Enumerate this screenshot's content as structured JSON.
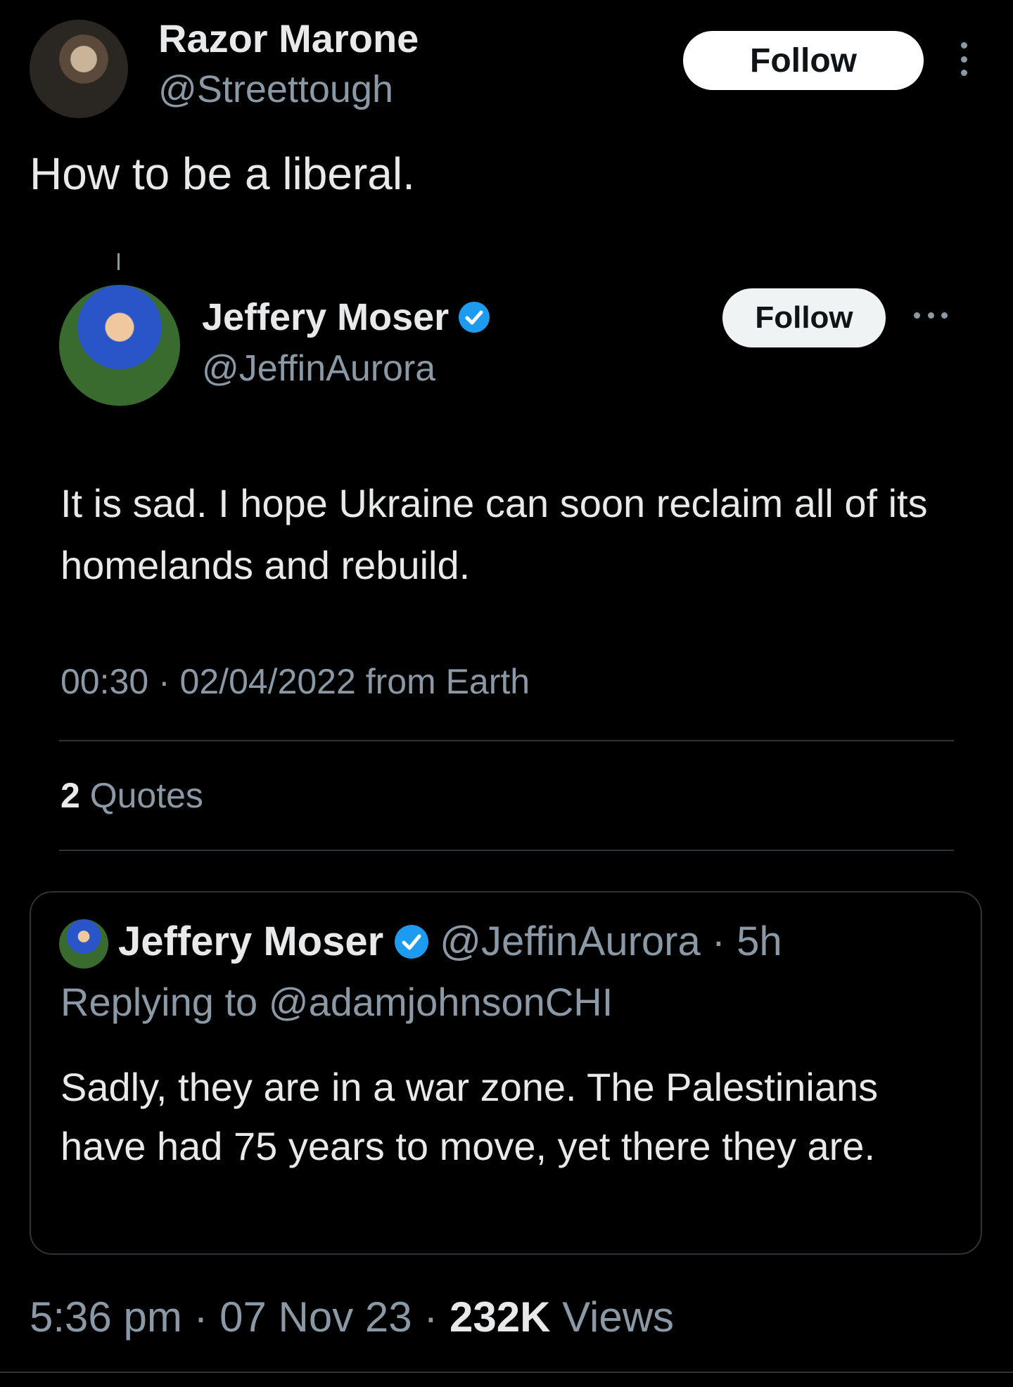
{
  "outer_tweet": {
    "display_name": "Razor Marone",
    "handle": "@Streettough",
    "follow_label": "Follow",
    "text": "How to be a liberal.",
    "time": "5:36 pm",
    "date": "07 Nov 23",
    "views_count": "232K",
    "views_label": "Views",
    "separator": "·"
  },
  "embedded_tweet": {
    "display_name": "Jeffery Moser",
    "verified": true,
    "handle": "@JeffinAurora",
    "follow_label": "Follow",
    "text": "It is sad. I hope Ukraine can soon reclaim all of its homelands and rebuild.",
    "meta": "00:30 · 02/04/2022 from Earth",
    "quotes_count": "2",
    "quotes_label": "Quotes"
  },
  "quoted_tweet": {
    "display_name": "Jeffery Moser",
    "verified": true,
    "handle": "@JeffinAurora",
    "age": "· 5h",
    "replying_to": "Replying to @adamjohnsonCHI",
    "text": "Sadly, they are in a war zone. The Palestinians have had 75 years to move, yet there they are."
  },
  "colors": {
    "background": "#000000",
    "primary_text": "#e7e9ea",
    "secondary_text": "#8b98a5",
    "verified_blue": "#1d9bf0",
    "divider": "#2f3336",
    "follow_button_bg": "#ffffff"
  },
  "icons": {
    "more_options": "vertical-ellipsis-icon",
    "more_options_inner": "horizontal-ellipsis-icon",
    "verified": "verified-badge-icon"
  }
}
